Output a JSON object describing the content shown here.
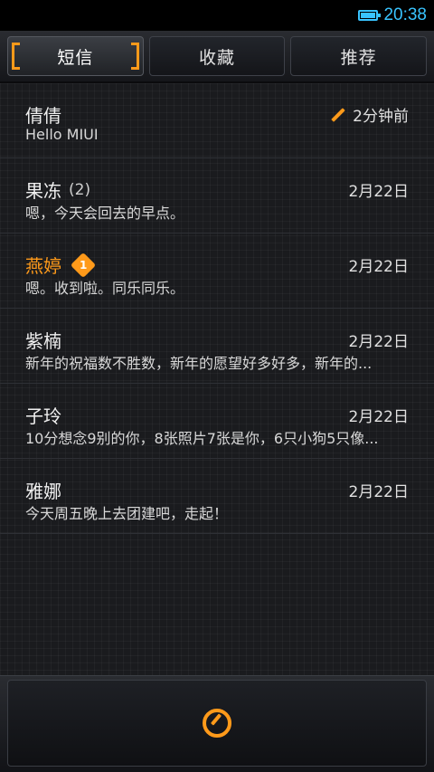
{
  "status_bar": {
    "time": "20:38"
  },
  "tabs": [
    {
      "label": "短信",
      "active": true
    },
    {
      "label": "收藏",
      "active": false
    },
    {
      "label": "推荐",
      "active": false
    }
  ],
  "conversations": [
    {
      "name": "倩倩",
      "count": "",
      "date": "2分钟前",
      "message": "Hello MIUI"
    },
    {
      "name": "果冻",
      "count": "(2)",
      "date": "2月22日",
      "message": "嗯，今天会回去的早点。"
    },
    {
      "name": "燕婷",
      "count": "",
      "badge": "1",
      "date": "2月22日",
      "message": "嗯。收到啦。同乐同乐。"
    },
    {
      "name": "紫楠",
      "count": "",
      "date": "2月22日",
      "message": "新年的祝福数不胜数，新年的愿望好多好多，新年的..."
    },
    {
      "name": "子玲",
      "count": "",
      "date": "2月22日",
      "message": "10分想念9别的你，8张照片7张是你，6只小狗5只像..."
    },
    {
      "name": "雅娜",
      "count": "",
      "date": "2月22日",
      "message": "今天周五晚上去团建吧，走起！"
    }
  ],
  "colors": {
    "accent": "#ff9a1a",
    "status": "#39c4ff"
  },
  "icons": {
    "battery": "battery-icon",
    "draft": "pencil-icon",
    "compose": "compose-icon"
  }
}
